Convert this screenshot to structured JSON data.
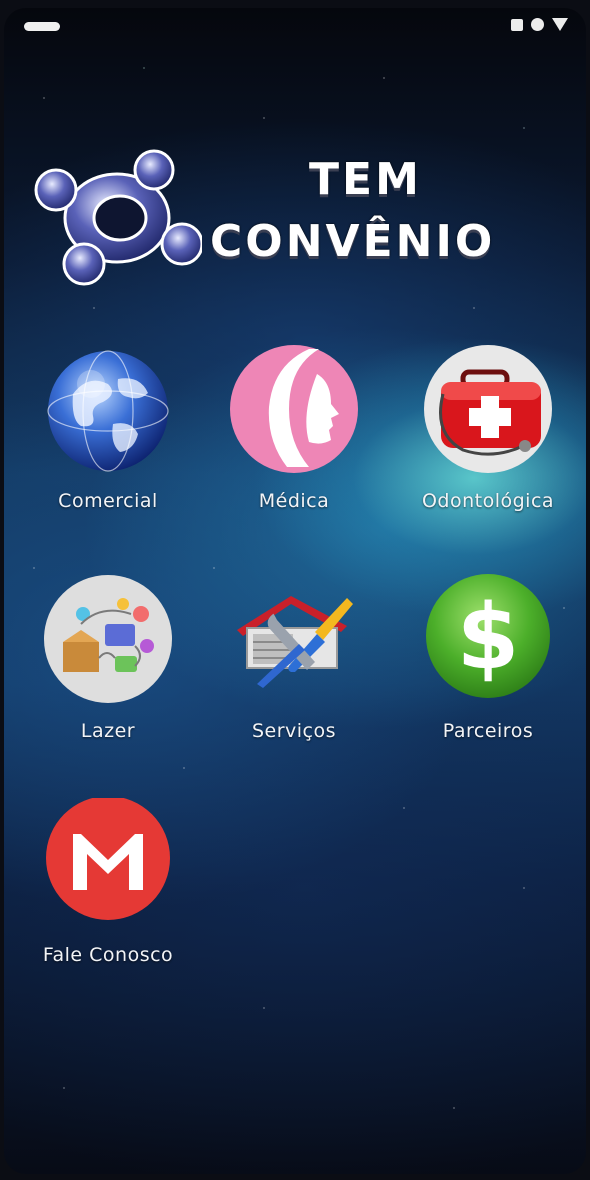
{
  "app": {
    "logo": {
      "line1": "TEM",
      "line2": "CONVÊNIO",
      "icon": "people-circle-logo-icon"
    }
  },
  "colors": {
    "background_dark": "#05070d",
    "nebula_cyan": "#6eebe1",
    "text": "#ffffff",
    "gmail_red": "#e53935",
    "dollar_green": "#4caf2a",
    "medical_pink": "#ee86b6"
  },
  "menu": {
    "items": [
      {
        "label": "Comercial",
        "icon": "globe-icon"
      },
      {
        "label": "Médica",
        "icon": "woman-profile-icon"
      },
      {
        "label": "Odontológica",
        "icon": "first-aid-kit-icon"
      },
      {
        "label": "Lazer",
        "icon": "leisure-icons-box-icon"
      },
      {
        "label": "Serviços",
        "icon": "house-tools-icon"
      },
      {
        "label": "Parceiros",
        "icon": "dollar-icon"
      },
      {
        "label": "Fale Conosco",
        "icon": "mail-icon"
      }
    ]
  }
}
